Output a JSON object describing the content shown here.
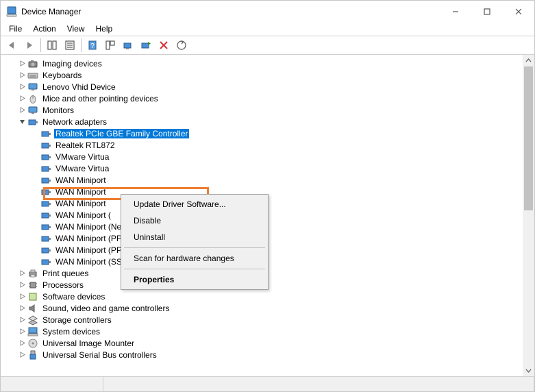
{
  "window": {
    "title": "Device Manager"
  },
  "menu": {
    "file": "File",
    "action": "Action",
    "view": "View",
    "help": "Help"
  },
  "tree": {
    "imaging": {
      "label": "Imaging devices"
    },
    "keyboards": {
      "label": "Keyboards"
    },
    "lenovo": {
      "label": "Lenovo Vhid Device"
    },
    "mice": {
      "label": "Mice and other pointing devices"
    },
    "monitors": {
      "label": "Monitors"
    },
    "network": {
      "label": "Network adapters"
    },
    "net": {
      "realtek_gbe": "Realtek PCIe GBE Family Controller",
      "realtek_8723": "Realtek RTL872",
      "vmnet1": "VMware Virtua",
      "vmnet8": "VMware Virtua",
      "wan_ikev2": "WAN Miniport",
      "wan_ip": "WAN Miniport",
      "wan_ipv6": "WAN Miniport",
      "wan_l2tp_cut": "WAN Miniport (",
      "wan_monitor": "WAN Miniport (Network Monitor)",
      "wan_pppoe": "WAN Miniport (PPPOE)",
      "wan_pptp": "WAN Miniport (PPTP)",
      "wan_sstp": "WAN Miniport (SSTP)"
    },
    "printqueues": {
      "label": "Print queues"
    },
    "processors": {
      "label": "Processors"
    },
    "software": {
      "label": "Software devices"
    },
    "sound": {
      "label": "Sound, video and game controllers"
    },
    "storage": {
      "label": "Storage controllers"
    },
    "system": {
      "label": "System devices"
    },
    "uim": {
      "label": "Universal Image Mounter"
    },
    "usb": {
      "label": "Universal Serial Bus controllers"
    }
  },
  "context_menu": {
    "update": "Update Driver Software...",
    "disable": "Disable",
    "uninstall": "Uninstall",
    "scan": "Scan for hardware changes",
    "properties": "Properties"
  }
}
